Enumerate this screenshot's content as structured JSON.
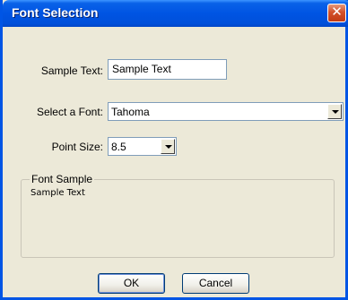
{
  "window": {
    "title": "Font Selection",
    "close_glyph": "✕"
  },
  "form": {
    "sample_text_label": "Sample Text:",
    "sample_text_value": "Sample Text",
    "font_label": "Select a Font:",
    "font_value": "Tahoma",
    "point_size_label": "Point Size:",
    "point_size_value": "8.5"
  },
  "preview": {
    "group_label": "Font Sample",
    "text": "Sample Text"
  },
  "buttons": {
    "ok": "OK",
    "cancel": "Cancel"
  },
  "colors": {
    "titlebar": "#0054e3",
    "close": "#d3522b",
    "dialog_bg": "#ece9d8"
  }
}
